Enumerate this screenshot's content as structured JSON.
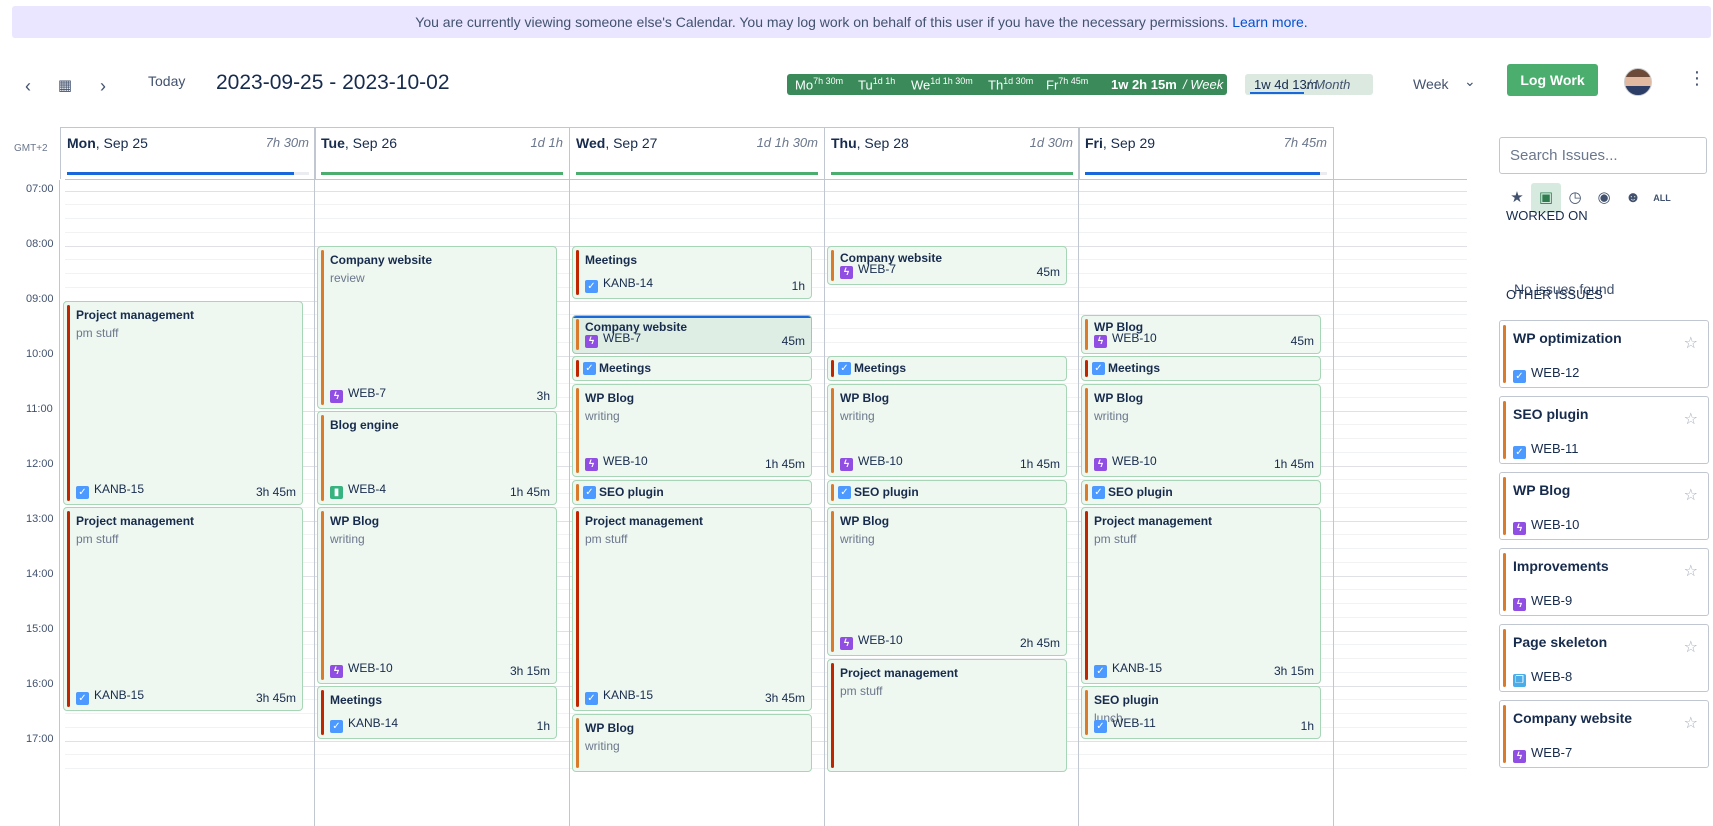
{
  "banner": {
    "text": "You are currently viewing someone else's Calendar. You may log work on behalf of this user if you have the necessary permissions.",
    "link": "Learn more."
  },
  "toolbar": {
    "prev_icon": "chevron-left-icon",
    "calendar_icon": "calendar-icon",
    "next_icon": "chevron-right-icon",
    "today_label": "Today",
    "range_title": "2023-09-25 - 2023-10-02",
    "week_summary": {
      "days": [
        {
          "abbr": "Mo",
          "time": "7h 30m"
        },
        {
          "abbr": "Tu",
          "time": "1d 1h"
        },
        {
          "abbr": "We",
          "time": "1d 1h 30m"
        },
        {
          "abbr": "Th",
          "time": "1d 30m"
        },
        {
          "abbr": "Fr",
          "time": "7h 45m"
        }
      ],
      "total": "1w 2h 15m",
      "label": "/ Week"
    },
    "month_summary": {
      "value": "1w 4d 13m",
      "label": "/ Month"
    },
    "view_label": "Week",
    "log_work_label": "Log Work",
    "accent": "#4cae6e"
  },
  "calendar": {
    "timezone": "GMT+2",
    "time_labels": [
      "07:00",
      "08:00",
      "09:00",
      "10:00",
      "11:00",
      "12:00",
      "13:00",
      "14:00",
      "15:00",
      "16:00",
      "17:00"
    ],
    "days": [
      {
        "dow": "Mon",
        "date": ", Sep 25",
        "total": "7h 30m",
        "progress": 0.94,
        "bar_color": "#1868db"
      },
      {
        "dow": "Tue",
        "date": ", Sep 26",
        "total": "1d 1h",
        "progress": 1.0,
        "bar_color": "#4cae6e"
      },
      {
        "dow": "Wed",
        "date": ", Sep 27",
        "total": "1d 1h 30m",
        "progress": 1.0,
        "bar_color": "#4cae6e"
      },
      {
        "dow": "Thu",
        "date": ", Sep 28",
        "total": "1d 30m",
        "progress": 1.0,
        "bar_color": "#4cae6e"
      },
      {
        "dow": "Fri",
        "date": ", Sep 29",
        "total": "7h 45m",
        "progress": 0.97,
        "bar_color": "#1868db"
      }
    ],
    "events": [
      {
        "title": "Project management",
        "desc": "pm stuff",
        "key": "KANB-15",
        "type": "task",
        "dur": "3h 45m",
        "edge": "#bf2600"
      },
      {
        "title": "Project management",
        "desc": "pm stuff",
        "key": "KANB-15",
        "type": "task",
        "dur": "3h 45m",
        "edge": "#bf2600"
      },
      {
        "title": "Company website",
        "desc": "review",
        "key": "WEB-7",
        "type": "epic",
        "dur": "3h",
        "edge": "#d97b2b"
      },
      {
        "title": "Blog engine",
        "desc": "",
        "key": "WEB-4",
        "type": "story",
        "dur": "1h 45m",
        "edge": "#d97b2b"
      },
      {
        "title": "WP Blog",
        "desc": "writing",
        "key": "WEB-10",
        "type": "epic",
        "dur": "3h 15m",
        "edge": "#d97b2b"
      },
      {
        "title": "Meetings",
        "desc": "",
        "key": "KANB-14",
        "type": "task",
        "dur": "1h",
        "edge": "#bf2600"
      },
      {
        "title": "Meetings",
        "desc": "",
        "key": "KANB-14",
        "type": "task",
        "dur": "1h",
        "edge": "#bf2600"
      },
      {
        "title": "Company website",
        "desc": "",
        "key": "WEB-7",
        "type": "epic",
        "dur": "45m",
        "edge": "#d97b2b"
      },
      {
        "title": "Meetings",
        "desc": "",
        "key": "",
        "type": "task",
        "dur": "",
        "edge": "#bf2600"
      },
      {
        "title": "WP Blog",
        "desc": "writing",
        "key": "WEB-10",
        "type": "epic",
        "dur": "1h 45m",
        "edge": "#d97b2b"
      },
      {
        "title": "SEO plugin",
        "desc": "",
        "key": "",
        "type": "task",
        "dur": "",
        "edge": "#d97b2b"
      },
      {
        "title": "Project management",
        "desc": "pm stuff",
        "key": "KANB-15",
        "type": "task",
        "dur": "3h 45m",
        "edge": "#bf2600"
      },
      {
        "title": "WP Blog",
        "desc": "writing",
        "key": "",
        "type": "epic",
        "dur": "",
        "edge": "#d97b2b"
      },
      {
        "title": "Company website",
        "desc": "",
        "key": "WEB-7",
        "type": "epic",
        "dur": "45m",
        "edge": "#d97b2b"
      },
      {
        "title": "Meetings",
        "desc": "",
        "key": "",
        "type": "task",
        "dur": "",
        "edge": "#bf2600"
      },
      {
        "title": "WP Blog",
        "desc": "writing",
        "key": "WEB-10",
        "type": "epic",
        "dur": "1h 45m",
        "edge": "#d97b2b"
      },
      {
        "title": "SEO plugin",
        "desc": "",
        "key": "",
        "type": "task",
        "dur": "",
        "edge": "#d97b2b"
      },
      {
        "title": "WP Blog",
        "desc": "writing",
        "key": "WEB-10",
        "type": "epic",
        "dur": "2h 45m",
        "edge": "#d97b2b"
      },
      {
        "title": "Project management",
        "desc": "pm stuff",
        "key": "",
        "type": "task",
        "dur": "",
        "edge": "#bf2600"
      },
      {
        "title": "WP Blog",
        "desc": "",
        "key": "WEB-10",
        "type": "epic",
        "dur": "45m",
        "edge": "#d97b2b"
      },
      {
        "title": "Meetings",
        "desc": "",
        "key": "",
        "type": "task",
        "dur": "",
        "edge": "#bf2600"
      },
      {
        "title": "WP Blog",
        "desc": "writing",
        "key": "WEB-10",
        "type": "epic",
        "dur": "1h 45m",
        "edge": "#d97b2b"
      },
      {
        "title": "SEO plugin",
        "desc": "",
        "key": "",
        "type": "task",
        "dur": "",
        "edge": "#d97b2b"
      },
      {
        "title": "Project management",
        "desc": "pm stuff",
        "key": "KANB-15",
        "type": "task",
        "dur": "3h 15m",
        "edge": "#bf2600"
      },
      {
        "title": "SEO plugin",
        "desc": "lunch",
        "key": "WEB-11",
        "type": "task",
        "dur": "1h",
        "edge": "#d97b2b"
      }
    ]
  },
  "panel": {
    "search_placeholder": "Search Issues...",
    "filters": [
      {
        "icon": "star-icon",
        "glyph": "★"
      },
      {
        "icon": "briefcase-icon",
        "glyph": "▣"
      },
      {
        "icon": "clock-icon",
        "glyph": "◷"
      },
      {
        "icon": "eye-icon",
        "glyph": "◉"
      },
      {
        "icon": "user-icon",
        "glyph": "☻"
      },
      {
        "icon": "all-icon",
        "glyph": "ALL"
      }
    ],
    "worked_on_title": "WORKED ON",
    "no_issues": "No issues found",
    "other_title": "OTHER ISSUES",
    "issues": [
      {
        "title": "WP optimization",
        "key": "WEB-12",
        "type": "task"
      },
      {
        "title": "SEO plugin",
        "key": "WEB-11",
        "type": "task"
      },
      {
        "title": "WP Blog",
        "key": "WEB-10",
        "type": "epic"
      },
      {
        "title": "Improvements",
        "key": "WEB-9",
        "type": "epic"
      },
      {
        "title": "Page skeleton",
        "key": "WEB-8",
        "type": "sub"
      },
      {
        "title": "Company website",
        "key": "WEB-7",
        "type": "epic"
      }
    ]
  }
}
